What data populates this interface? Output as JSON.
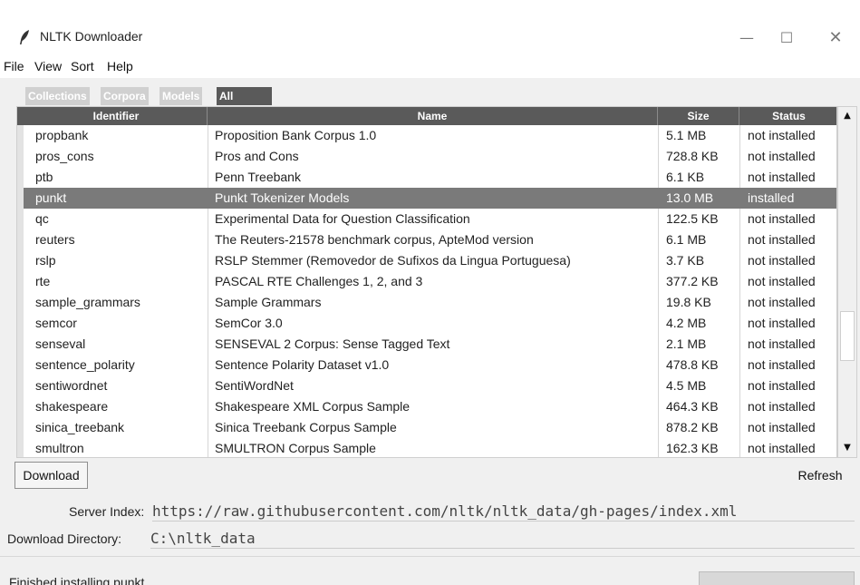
{
  "window": {
    "title": "NLTK Downloader",
    "controls": {
      "minimize": "—",
      "maximize": "☐",
      "close": "✕"
    }
  },
  "menu": [
    "File",
    "View",
    "Sort",
    "Help"
  ],
  "tabs": [
    {
      "label": "Collections",
      "active": false
    },
    {
      "label": "Corpora",
      "active": false
    },
    {
      "label": "Models",
      "active": false
    },
    {
      "label": "All Packages",
      "active": true
    }
  ],
  "table": {
    "columns": [
      "Identifier",
      "Name",
      "Size",
      "Status"
    ],
    "selected_index": 3,
    "rows": [
      {
        "identifier": "propbank",
        "name": "Proposition Bank Corpus 1.0",
        "size": "5.1 MB",
        "status": "not installed"
      },
      {
        "identifier": "pros_cons",
        "name": "Pros and Cons",
        "size": "728.8 KB",
        "status": "not installed"
      },
      {
        "identifier": "ptb",
        "name": "Penn Treebank",
        "size": "6.1 KB",
        "status": "not installed"
      },
      {
        "identifier": "punkt",
        "name": "Punkt Tokenizer Models",
        "size": "13.0 MB",
        "status": "installed"
      },
      {
        "identifier": "qc",
        "name": "Experimental Data for Question Classification",
        "size": "122.5 KB",
        "status": "not installed"
      },
      {
        "identifier": "reuters",
        "name": "The Reuters-21578 benchmark corpus, ApteMod version",
        "size": "6.1 MB",
        "status": "not installed"
      },
      {
        "identifier": "rslp",
        "name": "RSLP Stemmer (Removedor de Sufixos da Lingua Portuguesa)",
        "size": "3.7 KB",
        "status": "not installed"
      },
      {
        "identifier": "rte",
        "name": "PASCAL RTE Challenges 1, 2, and 3",
        "size": "377.2 KB",
        "status": "not installed"
      },
      {
        "identifier": "sample_grammars",
        "name": "Sample Grammars",
        "size": "19.8 KB",
        "status": "not installed"
      },
      {
        "identifier": "semcor",
        "name": "SemCor 3.0",
        "size": "4.2 MB",
        "status": "not installed"
      },
      {
        "identifier": "senseval",
        "name": "SENSEVAL 2 Corpus: Sense Tagged Text",
        "size": "2.1 MB",
        "status": "not installed"
      },
      {
        "identifier": "sentence_polarity",
        "name": "Sentence Polarity Dataset v1.0",
        "size": "478.8 KB",
        "status": "not installed"
      },
      {
        "identifier": "sentiwordnet",
        "name": "SentiWordNet",
        "size": "4.5 MB",
        "status": "not installed"
      },
      {
        "identifier": "shakespeare",
        "name": "Shakespeare XML Corpus Sample",
        "size": "464.3 KB",
        "status": "not installed"
      },
      {
        "identifier": "sinica_treebank",
        "name": "Sinica Treebank Corpus Sample",
        "size": "878.2 KB",
        "status": "not installed"
      },
      {
        "identifier": "smultron",
        "name": "SMULTRON Corpus Sample",
        "size": "162.3 KB",
        "status": "not installed"
      }
    ]
  },
  "buttons": {
    "download": "Download",
    "refresh": "Refresh"
  },
  "server_index": {
    "label": "Server Index:",
    "value": "https://raw.githubusercontent.com/nltk/nltk_data/gh-pages/index.xml"
  },
  "download_directory": {
    "label": "Download Directory:",
    "value": "C:\\nltk_data"
  },
  "status": {
    "message": "Finished installing punkt",
    "progress": 0
  },
  "colors": {
    "header_bg": "#5a5a5a",
    "selected_row_bg": "#7a7a7a",
    "tab_inactive_bg": "#d0d0d0"
  },
  "icons": {
    "app": "feather-icon",
    "scroll_up": "triangle-up-icon",
    "scroll_down": "triangle-down-icon"
  }
}
